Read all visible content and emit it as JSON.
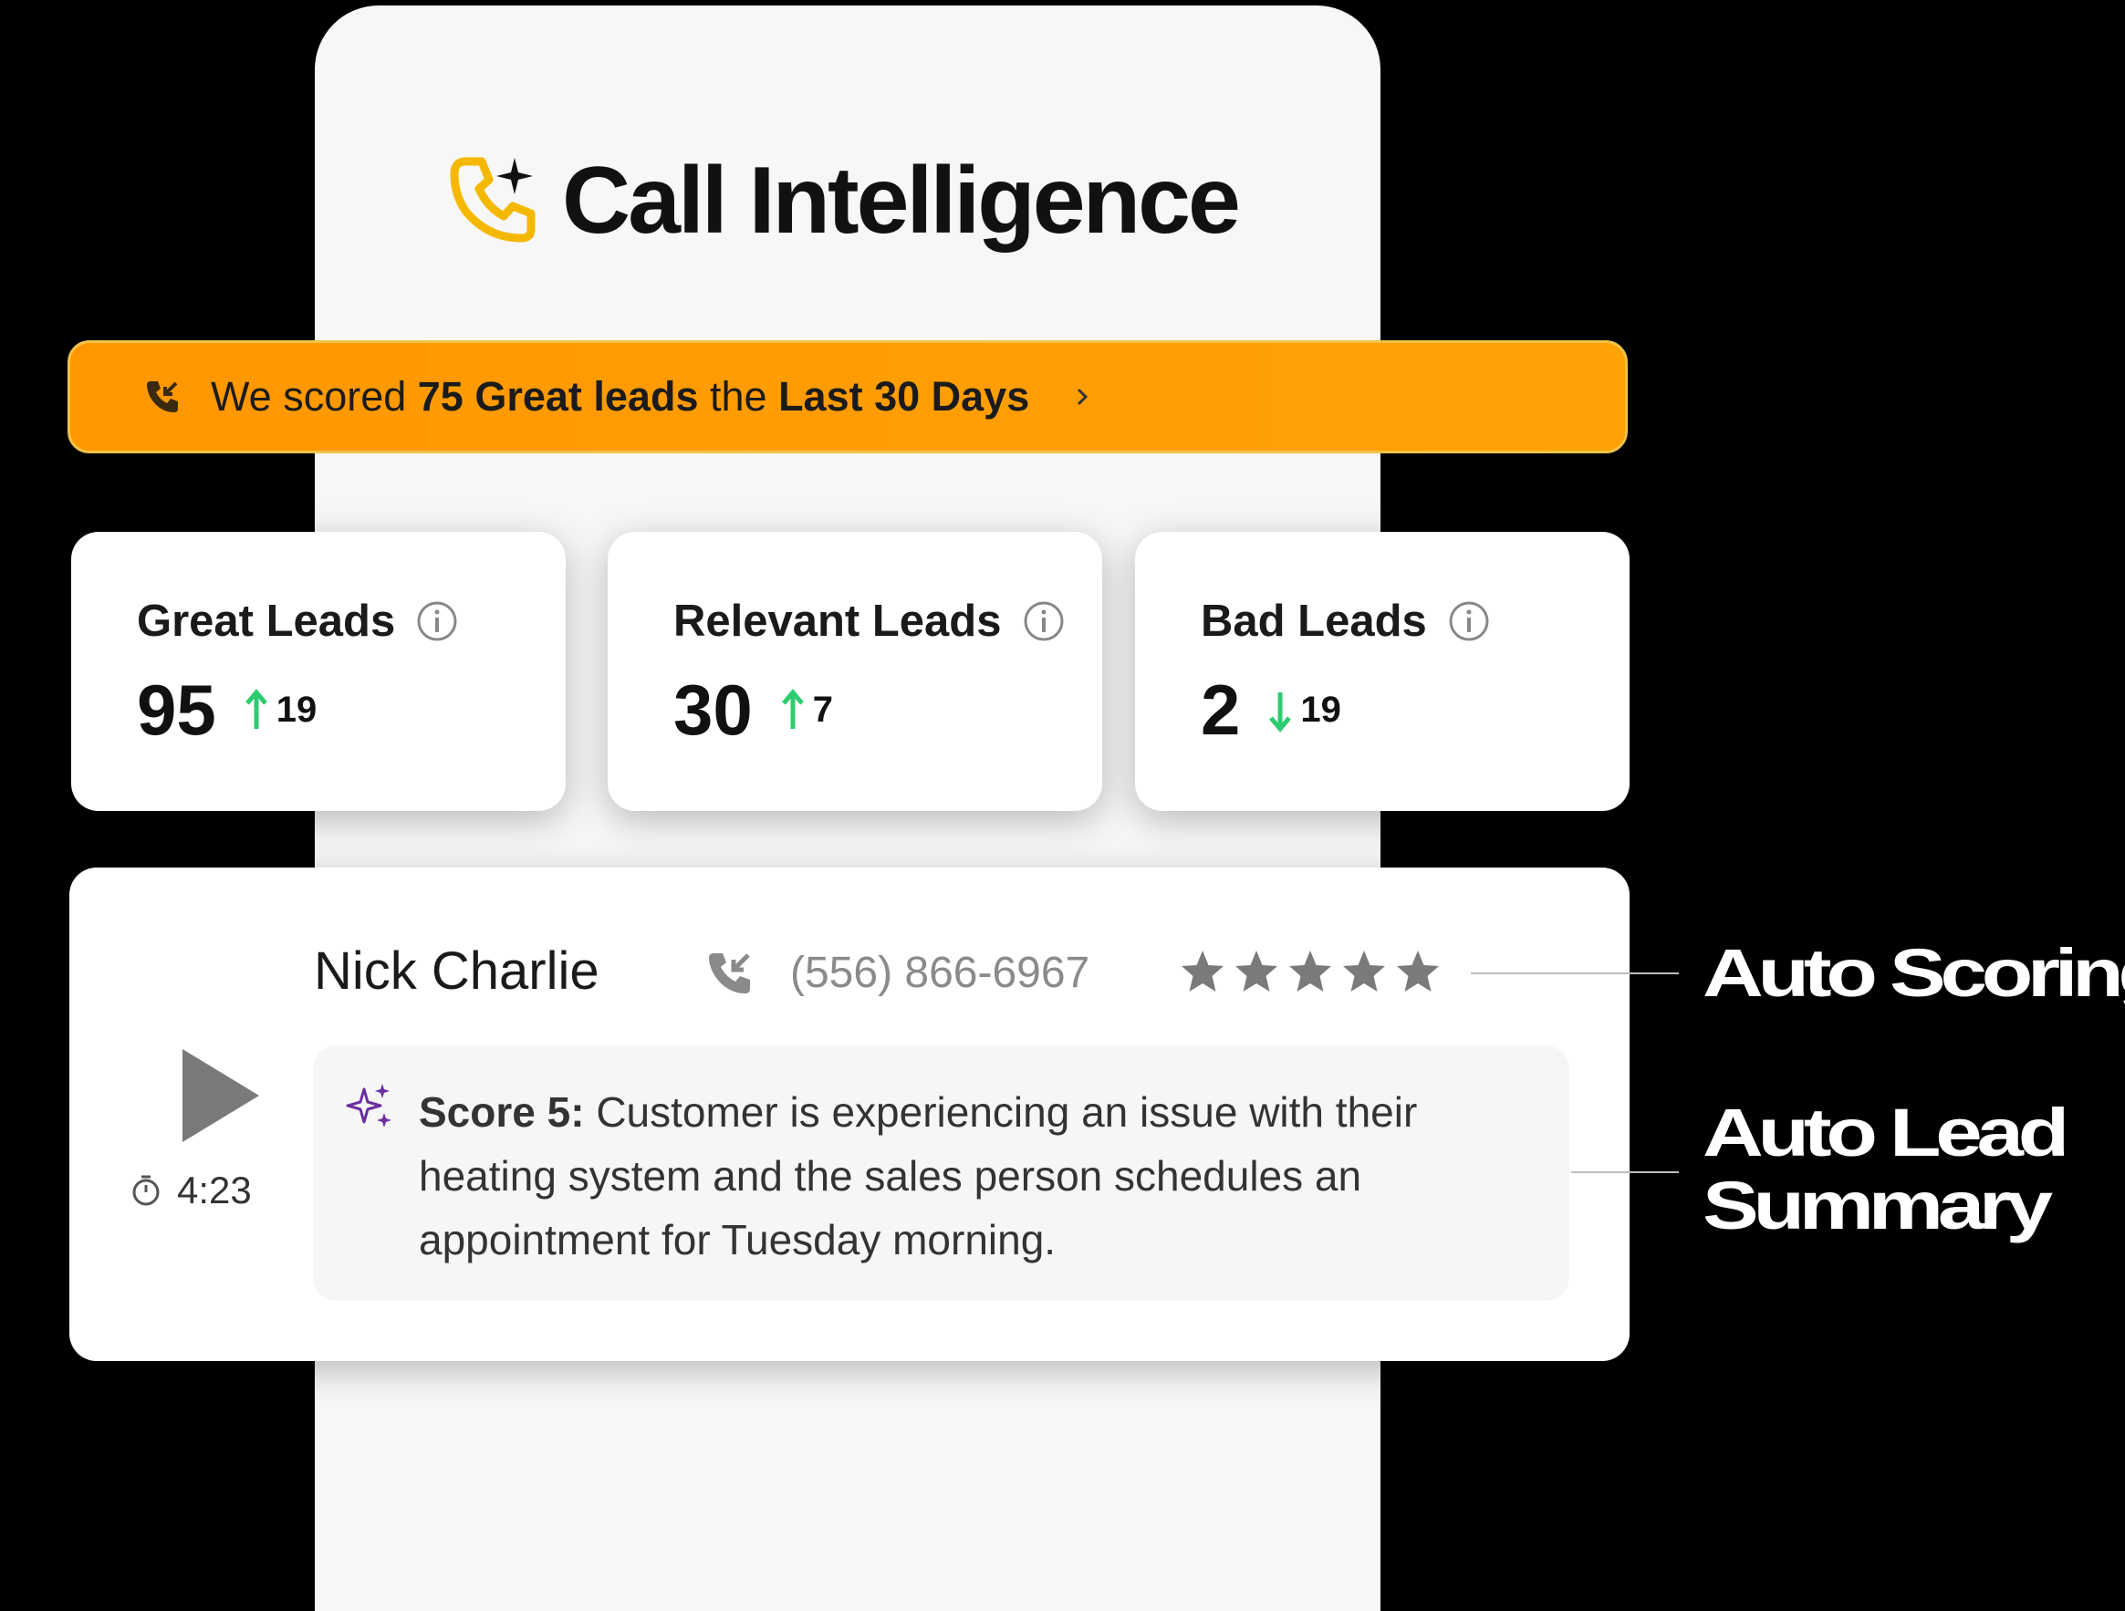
{
  "app": {
    "title": "Call Intelligence",
    "logo_icon": "phone-sparkle-icon",
    "logo_color": "#F5B800"
  },
  "banner": {
    "icon": "incoming-call-icon",
    "prefix": "We scored",
    "highlight1": "75 Great leads",
    "middle": "the",
    "highlight2": "Last 30 Days",
    "chevron": "chevron-right-icon",
    "color": "#FF9A00"
  },
  "stats": [
    {
      "label": "Great Leads",
      "value": "95",
      "trend": "up",
      "delta": "19"
    },
    {
      "label": "Relevant Leads",
      "value": "30",
      "trend": "up",
      "delta": "7"
    },
    {
      "label": "Bad Leads",
      "value": "2",
      "trend": "down",
      "delta": "19"
    }
  ],
  "trend_color": "#2ECC71",
  "call": {
    "name": "Nick Charlie",
    "phone": "(556) 866-6967",
    "rating": 5,
    "rating_max": 5,
    "duration": "4:23",
    "summary_label": "Score 5:",
    "summary_text": "Customer is experiencing an issue with their heating system and the sales person schedules an appointment for Tuesday morning."
  },
  "annotations": {
    "scoring": "Auto Scoring",
    "summary_line1": "Auto Lead",
    "summary_line2": "Summary"
  }
}
